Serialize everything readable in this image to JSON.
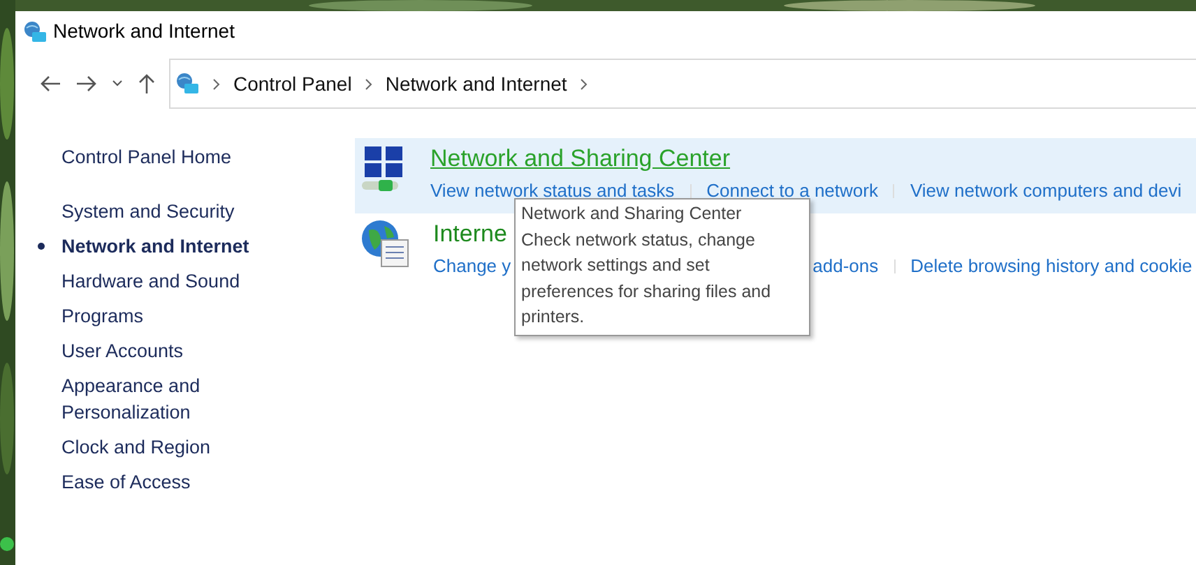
{
  "window": {
    "title": "Network and Internet"
  },
  "nav": {
    "back_disabled": false,
    "forward_disabled": false
  },
  "breadcrumb": [
    "Control Panel",
    "Network and Internet"
  ],
  "sidebar": {
    "home": "Control Panel Home",
    "items": [
      {
        "label": "System and Security",
        "selected": false
      },
      {
        "label": "Network and Internet",
        "selected": true
      },
      {
        "label": "Hardware and Sound",
        "selected": false
      },
      {
        "label": "Programs",
        "selected": false
      },
      {
        "label": "User Accounts",
        "selected": false
      },
      {
        "label": "Appearance and Personalization",
        "selected": false
      },
      {
        "label": "Clock and Region",
        "selected": false
      },
      {
        "label": "Ease of Access",
        "selected": false
      }
    ]
  },
  "categories": [
    {
      "kind": "network",
      "title": "Network and Sharing Center",
      "hovered": true,
      "links": [
        "View network status and tasks",
        "Connect to a network",
        "View network computers and devi"
      ]
    },
    {
      "kind": "internet",
      "title": "Interne",
      "hovered": false,
      "links": [
        "Change y",
        "add-ons",
        "Delete browsing history and cookie"
      ]
    }
  ],
  "tooltip": {
    "title": "Network and Sharing Center",
    "text": "Check network status, change network settings and set preferences for sharing files and printers."
  }
}
